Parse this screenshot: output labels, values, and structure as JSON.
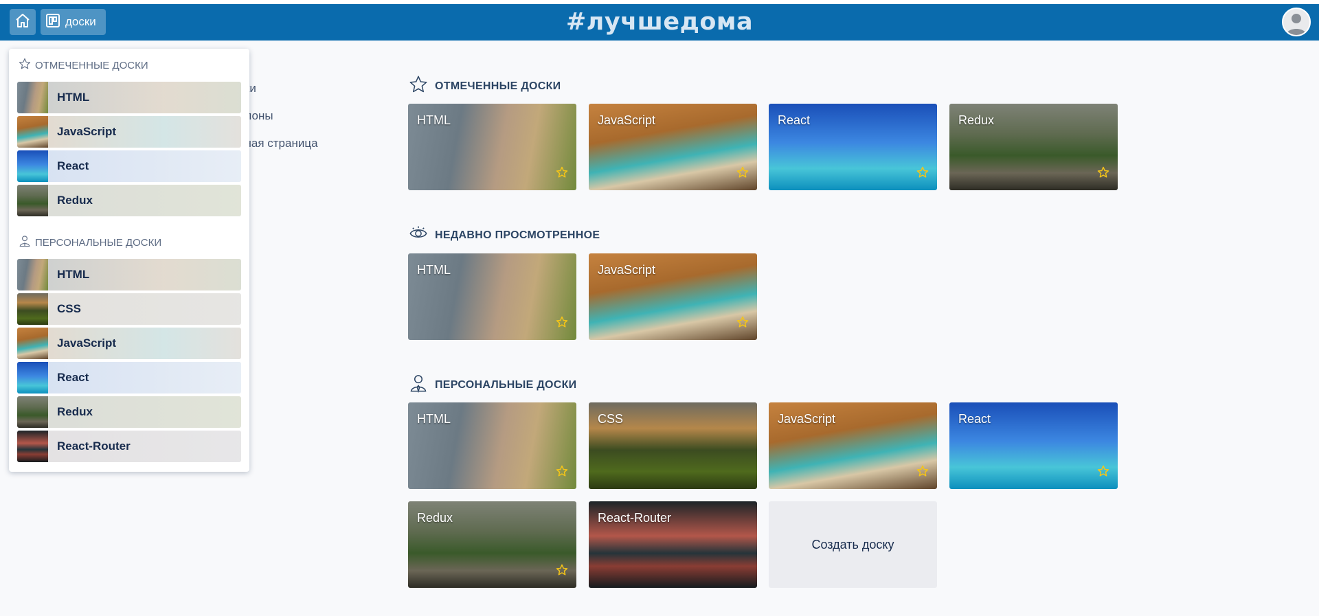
{
  "header": {
    "boards_button_label": "доски",
    "logo_text": "#лучшедома"
  },
  "left_nav": {
    "items": [
      {
        "label": "оски"
      },
      {
        "label": "аблоны"
      },
      {
        "label": "авная страница"
      }
    ]
  },
  "dropdown": {
    "starred_title": "ОТМЕЧЕННЫЕ ДОСКИ",
    "starred_items": [
      {
        "label": "HTML",
        "bg": "html"
      },
      {
        "label": "JavaScript",
        "bg": "js"
      },
      {
        "label": "React",
        "bg": "react"
      },
      {
        "label": "Redux",
        "bg": "redux"
      }
    ],
    "personal_title": "ПЕРСОНАЛЬНЫЕ ДОСКИ",
    "personal_items": [
      {
        "label": "HTML",
        "bg": "html"
      },
      {
        "label": "CSS",
        "bg": "css"
      },
      {
        "label": "JavaScript",
        "bg": "js"
      },
      {
        "label": "React",
        "bg": "react"
      },
      {
        "label": "Redux",
        "bg": "redux"
      },
      {
        "label": "React-Router",
        "bg": "router"
      }
    ]
  },
  "sections": {
    "starred": {
      "title": "ОТМЕЧЕННЫЕ ДОСКИ",
      "boards": [
        {
          "label": "HTML",
          "bg": "html"
        },
        {
          "label": "JavaScript",
          "bg": "js"
        },
        {
          "label": "React",
          "bg": "react"
        },
        {
          "label": "Redux",
          "bg": "redux"
        }
      ]
    },
    "recent": {
      "title": "НЕДАВНО ПРОСМОТРЕННОЕ",
      "boards": [
        {
          "label": "HTML",
          "bg": "html"
        },
        {
          "label": "JavaScript",
          "bg": "js"
        }
      ]
    },
    "personal": {
      "title": "ПЕРСОНАЛЬНЫЕ ДОСКИ",
      "boards": [
        {
          "label": "HTML",
          "bg": "html"
        },
        {
          "label": "CSS",
          "bg": "css"
        },
        {
          "label": "JavaScript",
          "bg": "js"
        },
        {
          "label": "React",
          "bg": "react"
        },
        {
          "label": "Redux",
          "bg": "redux"
        },
        {
          "label": "React-Router",
          "bg": "router"
        }
      ],
      "create_label": "Создать доску"
    }
  },
  "colors": {
    "header_bg": "#0a6bad",
    "star_color": "#f5c518"
  }
}
